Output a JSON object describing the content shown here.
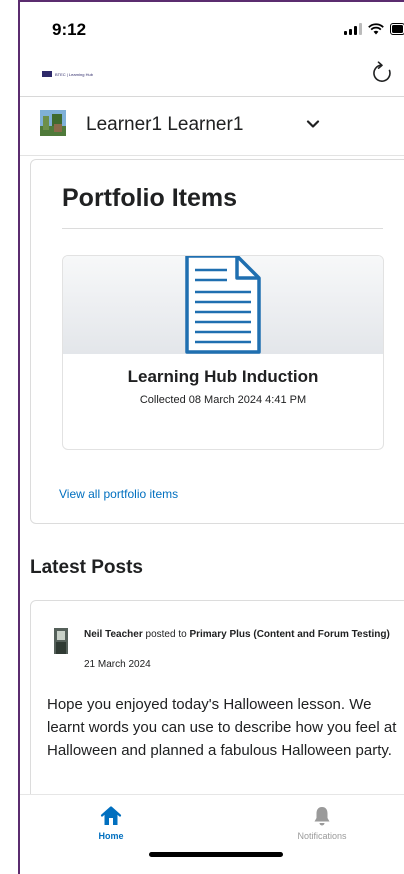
{
  "status_bar": {
    "time": "9:12"
  },
  "header": {
    "logo_text": "BTEC | Learning Hub",
    "refresh_icon": "refresh-icon"
  },
  "user": {
    "name": "Learner1 Learner1",
    "chevron_icon": "chevron-down-icon"
  },
  "portfolio": {
    "title": "Portfolio Items",
    "item": {
      "title": "Learning Hub Induction",
      "subtitle": "Collected 08 March 2024 4:41 PM",
      "icon": "document-icon"
    },
    "view_all": "View all portfolio items"
  },
  "latest_posts": {
    "title": "Latest Posts",
    "post": {
      "author": "Neil Teacher",
      "posted_to_text": " posted to ",
      "course": "Primary Plus (Content and Forum Testing)",
      "date": "21 March 2024",
      "body": "Hope you enjoyed today's Halloween lesson. We learnt words you can use to describe how you feel at Halloween and planned a fabulous Halloween party."
    }
  },
  "tabs": [
    {
      "label": "Home",
      "icon": "home-icon",
      "active": true
    },
    {
      "label": "Notifications",
      "icon": "bell-icon",
      "active": false
    }
  ],
  "colors": {
    "accent": "#006fbf",
    "frame": "#5b2c6f",
    "icon_blue": "#1f6fb0"
  }
}
